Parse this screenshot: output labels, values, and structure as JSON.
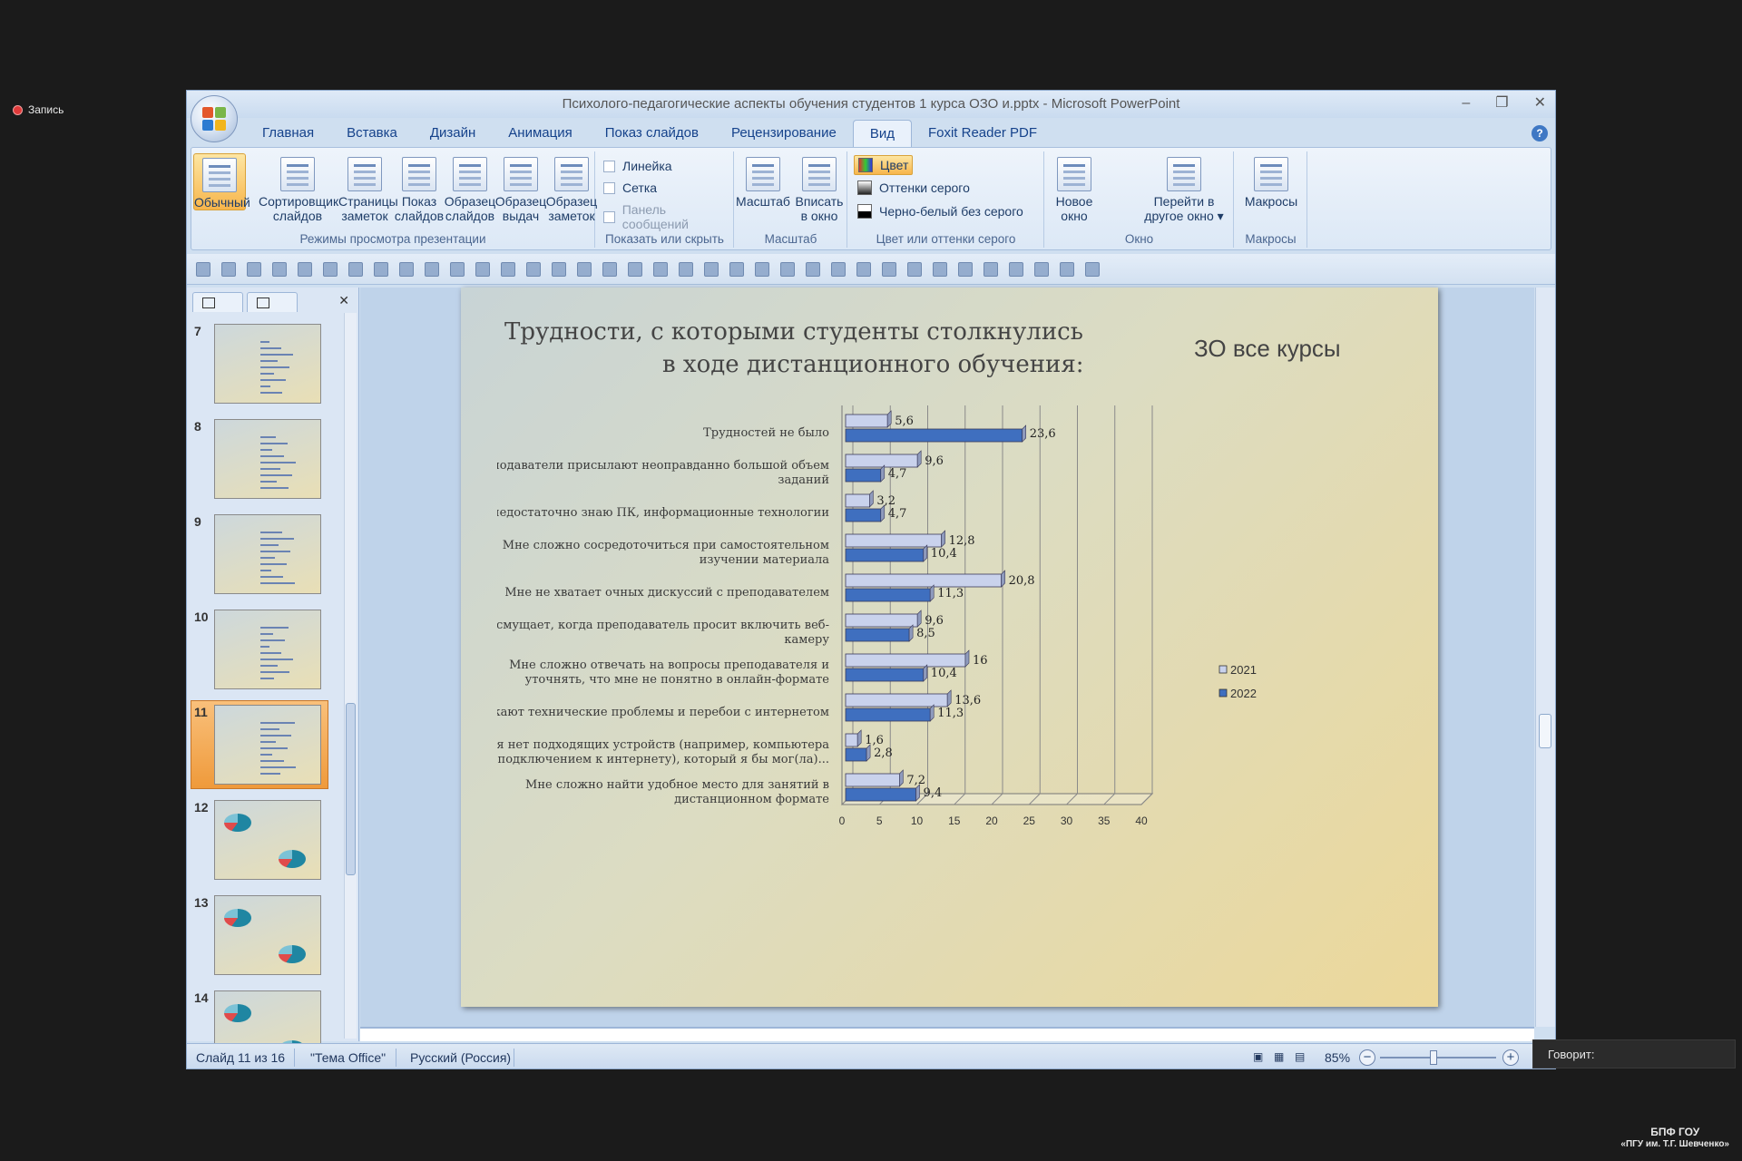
{
  "recording": "Запись",
  "window": {
    "title": "Психолого-педагогические аспекты обучения студентов 1 курса ОЗО и.pptx - Microsoft PowerPoint",
    "tabs": [
      "Главная",
      "Вставка",
      "Дизайн",
      "Анимация",
      "Показ слайдов",
      "Рецензирование",
      "Вид",
      "Foxit Reader PDF"
    ],
    "active_tab": "Вид"
  },
  "ribbon": {
    "views": {
      "caption": "Режимы просмотра презентации",
      "buttons": [
        {
          "l1": "Обычный",
          "l2": ""
        },
        {
          "l1": "Сортировщик",
          "l2": "слайдов"
        },
        {
          "l1": "Страницы",
          "l2": "заметок"
        },
        {
          "l1": "Показ",
          "l2": "слайдов"
        },
        {
          "l1": "Образец",
          "l2": "слайдов"
        },
        {
          "l1": "Образец",
          "l2": "выдач"
        },
        {
          "l1": "Образец",
          "l2": "заметок"
        }
      ]
    },
    "show": {
      "caption": "Показать или скрыть",
      "ruler": "Линейка",
      "grid": "Сетка",
      "msgbar": "Панель сообщений"
    },
    "zoom": {
      "caption": "Масштаб",
      "zoom_l1": "Масштаб",
      "fit_l1": "Вписать",
      "fit_l2": "в окно"
    },
    "color": {
      "caption": "Цвет или оттенки серого",
      "color": "Цвет",
      "gray": "Оттенки серого",
      "bw": "Черно-белый без серого"
    },
    "window": {
      "caption": "Окно",
      "new_l1": "Новое",
      "new_l2": "окно",
      "switch_l1": "Перейти в",
      "switch_l2": "другое окно"
    },
    "macros": {
      "caption": "Макросы",
      "label": "Макросы"
    }
  },
  "slides": [
    {
      "num": "7",
      "kind": "bars"
    },
    {
      "num": "8",
      "kind": "bars"
    },
    {
      "num": "9",
      "kind": "bars"
    },
    {
      "num": "10",
      "kind": "bars"
    },
    {
      "num": "11",
      "kind": "bars",
      "selected": true
    },
    {
      "num": "12",
      "kind": "pies"
    },
    {
      "num": "13",
      "kind": "pies"
    },
    {
      "num": "14",
      "kind": "pies"
    }
  ],
  "slide": {
    "title_line1": "Трудности, с которыми студенты столкнулись",
    "title_line2": "в ходе дистанционного обучения:",
    "subtitle": "ЗО  все курсы"
  },
  "chart_data": {
    "type": "bar",
    "orientation": "horizontal",
    "categories": [
      [
        "Трудностей не было"
      ],
      [
        "Преподаватели присылают неоправданно большой объем",
        "заданий"
      ],
      [
        "Я  недостаточно знаю ПК, информационные технологии"
      ],
      [
        "Мне сложно сосредоточиться  при самостоятельном",
        "изучении материала"
      ],
      [
        "Мне не хватает очных дискуссий с преподавателем"
      ],
      [
        "Меня смущает, когда преподаватель просит включить веб-",
        "камеру"
      ],
      [
        "Мне сложно отвечать на вопросы преподавателя и",
        "уточнять, что мне не понятно в онлайн-формате"
      ],
      [
        "Возникают технические проблемы и перебои с интернетом"
      ],
      [
        "У меня нет подходящих устройств (например, компьютера",
        "с подключением к интернету), который я бы мог(ла)..."
      ],
      [
        "Мне сложно найти удобное  место для занятий в",
        "дистанционном формате"
      ]
    ],
    "series": [
      {
        "name": "2021",
        "values": [
          5.6,
          9.6,
          3.2,
          12.8,
          20.8,
          9.6,
          16,
          13.6,
          1.6,
          7.2
        ],
        "labels": [
          "5,6",
          "9,6",
          "3,2",
          "12,8",
          "20,8",
          "9,6",
          "16",
          "13,6",
          "1,6",
          "7,2"
        ],
        "color": "#c9d2ec"
      },
      {
        "name": "2022",
        "values": [
          23.6,
          4.7,
          4.7,
          10.4,
          11.3,
          8.5,
          10.4,
          11.3,
          2.8,
          9.4
        ],
        "labels": [
          "23,6",
          "4,7",
          "4,7",
          "10,4",
          "11,3",
          "8,5",
          "10,4",
          "11,3",
          "2,8",
          "9,4"
        ],
        "color": "#3f6fbf"
      }
    ],
    "xlim": [
      0,
      40
    ],
    "xticks": [
      "0",
      "5",
      "10",
      "15",
      "20",
      "25",
      "30",
      "35",
      "40"
    ],
    "grid": true,
    "legend": "right"
  },
  "status": {
    "slide": "Слайд 11 из 16",
    "theme": "\"Тема Office\"",
    "lang": "Русский (Россия)",
    "zoom": "85%"
  },
  "speaking": "Говорит:",
  "brand": {
    "line1": "БПФ ГОУ",
    "line2": "«ПГУ им. Т.Г. Шевченко»"
  }
}
